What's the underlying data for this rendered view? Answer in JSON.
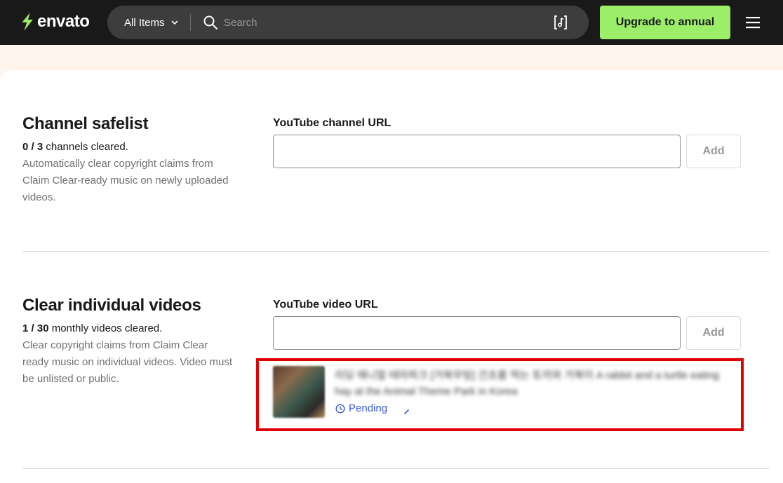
{
  "header": {
    "logo_text": "envato",
    "filter_label": "All Items",
    "search_placeholder": "Search",
    "upgrade_label": "Upgrade to annual"
  },
  "channel_safelist": {
    "title": "Channel safelist",
    "count_used": "0",
    "count_sep": " / ",
    "count_total": "3",
    "count_suffix": " channels cleared.",
    "description": "Automatically clear copyright claims from Claim Clear-ready music on newly uploaded videos.",
    "field_label": "YouTube channel URL",
    "input_value": "",
    "add_label": "Add"
  },
  "individual_videos": {
    "title": "Clear individual videos",
    "count_used": "1",
    "count_sep": " / ",
    "count_total": "30",
    "count_suffix": " monthly videos cleared.",
    "description": "Clear copyright claims from Claim Clear ready music on individual videos. Video must be unlisted or public.",
    "field_label": "YouTube video URL",
    "input_value": "",
    "add_label": "Add",
    "videos": [
      {
        "title": "리딩 애니멀 테마파크 [거북무빙] 건초를 먹는 토끼와 거북이 A rabbit and a turtle eating hay at the Animal Theme Park in Korea",
        "status": "Pending"
      }
    ]
  },
  "colors": {
    "brand_green": "#9cee69",
    "header_bg": "#191919",
    "page_bg": "#fff4ec",
    "pending_blue": "#3a5bd9",
    "highlight_red": "#e00000"
  },
  "icons": [
    "envato-leaf-icon",
    "chevron-down-icon",
    "search-icon",
    "music-search-icon",
    "menu-icon",
    "clock-icon"
  ]
}
